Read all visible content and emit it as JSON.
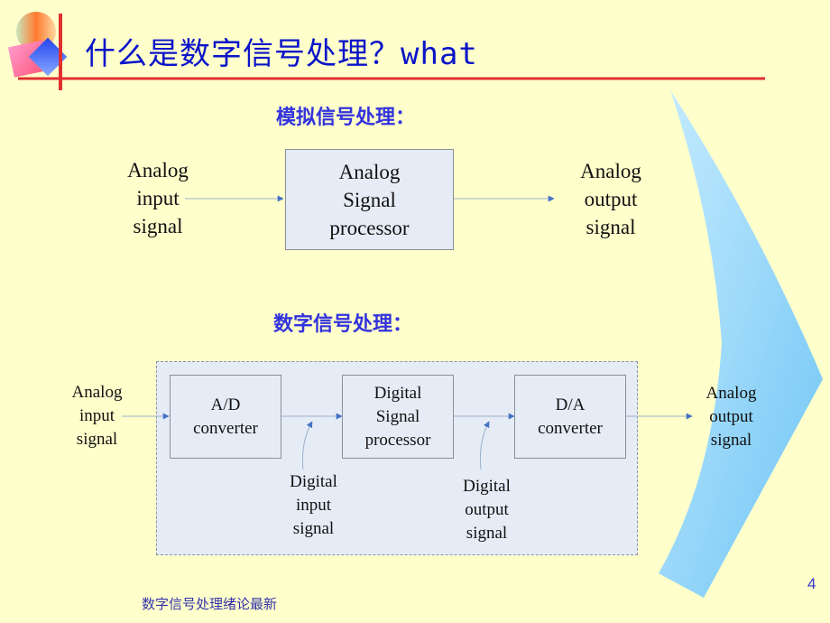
{
  "slide": {
    "title_cn": "什么是数字信号处理？",
    "title_en": "what",
    "page_number": "4",
    "footer": "数字信号处理绪论最新"
  },
  "analog_section": {
    "heading": "模拟信号处理：",
    "input_label": [
      "Analog",
      "input",
      "signal"
    ],
    "processor_label": [
      "Analog",
      "Signal",
      "processor"
    ],
    "output_label": [
      "Analog",
      "output",
      "signal"
    ]
  },
  "digital_section": {
    "heading": "数字信号处理：",
    "input_label": [
      "Analog",
      "input",
      "signal"
    ],
    "ad_converter_label": [
      "A/D",
      "converter"
    ],
    "dsp_label": [
      "Digital",
      "Signal",
      "processor"
    ],
    "da_converter_label": [
      "D/A",
      "converter"
    ],
    "output_label": [
      "Analog",
      "output",
      "signal"
    ],
    "digital_input_label": [
      "Digital",
      "input",
      "signal"
    ],
    "digital_output_label": [
      "Digital",
      "output",
      "signal"
    ]
  },
  "colors": {
    "background": "#ffffcc",
    "title": "#0a14c8",
    "heading": "#3333dd",
    "rule": "#e03030",
    "arrow": "#4472c4",
    "box_fill": "#e6ecf6",
    "decor_blue": "#8fd0f8"
  }
}
